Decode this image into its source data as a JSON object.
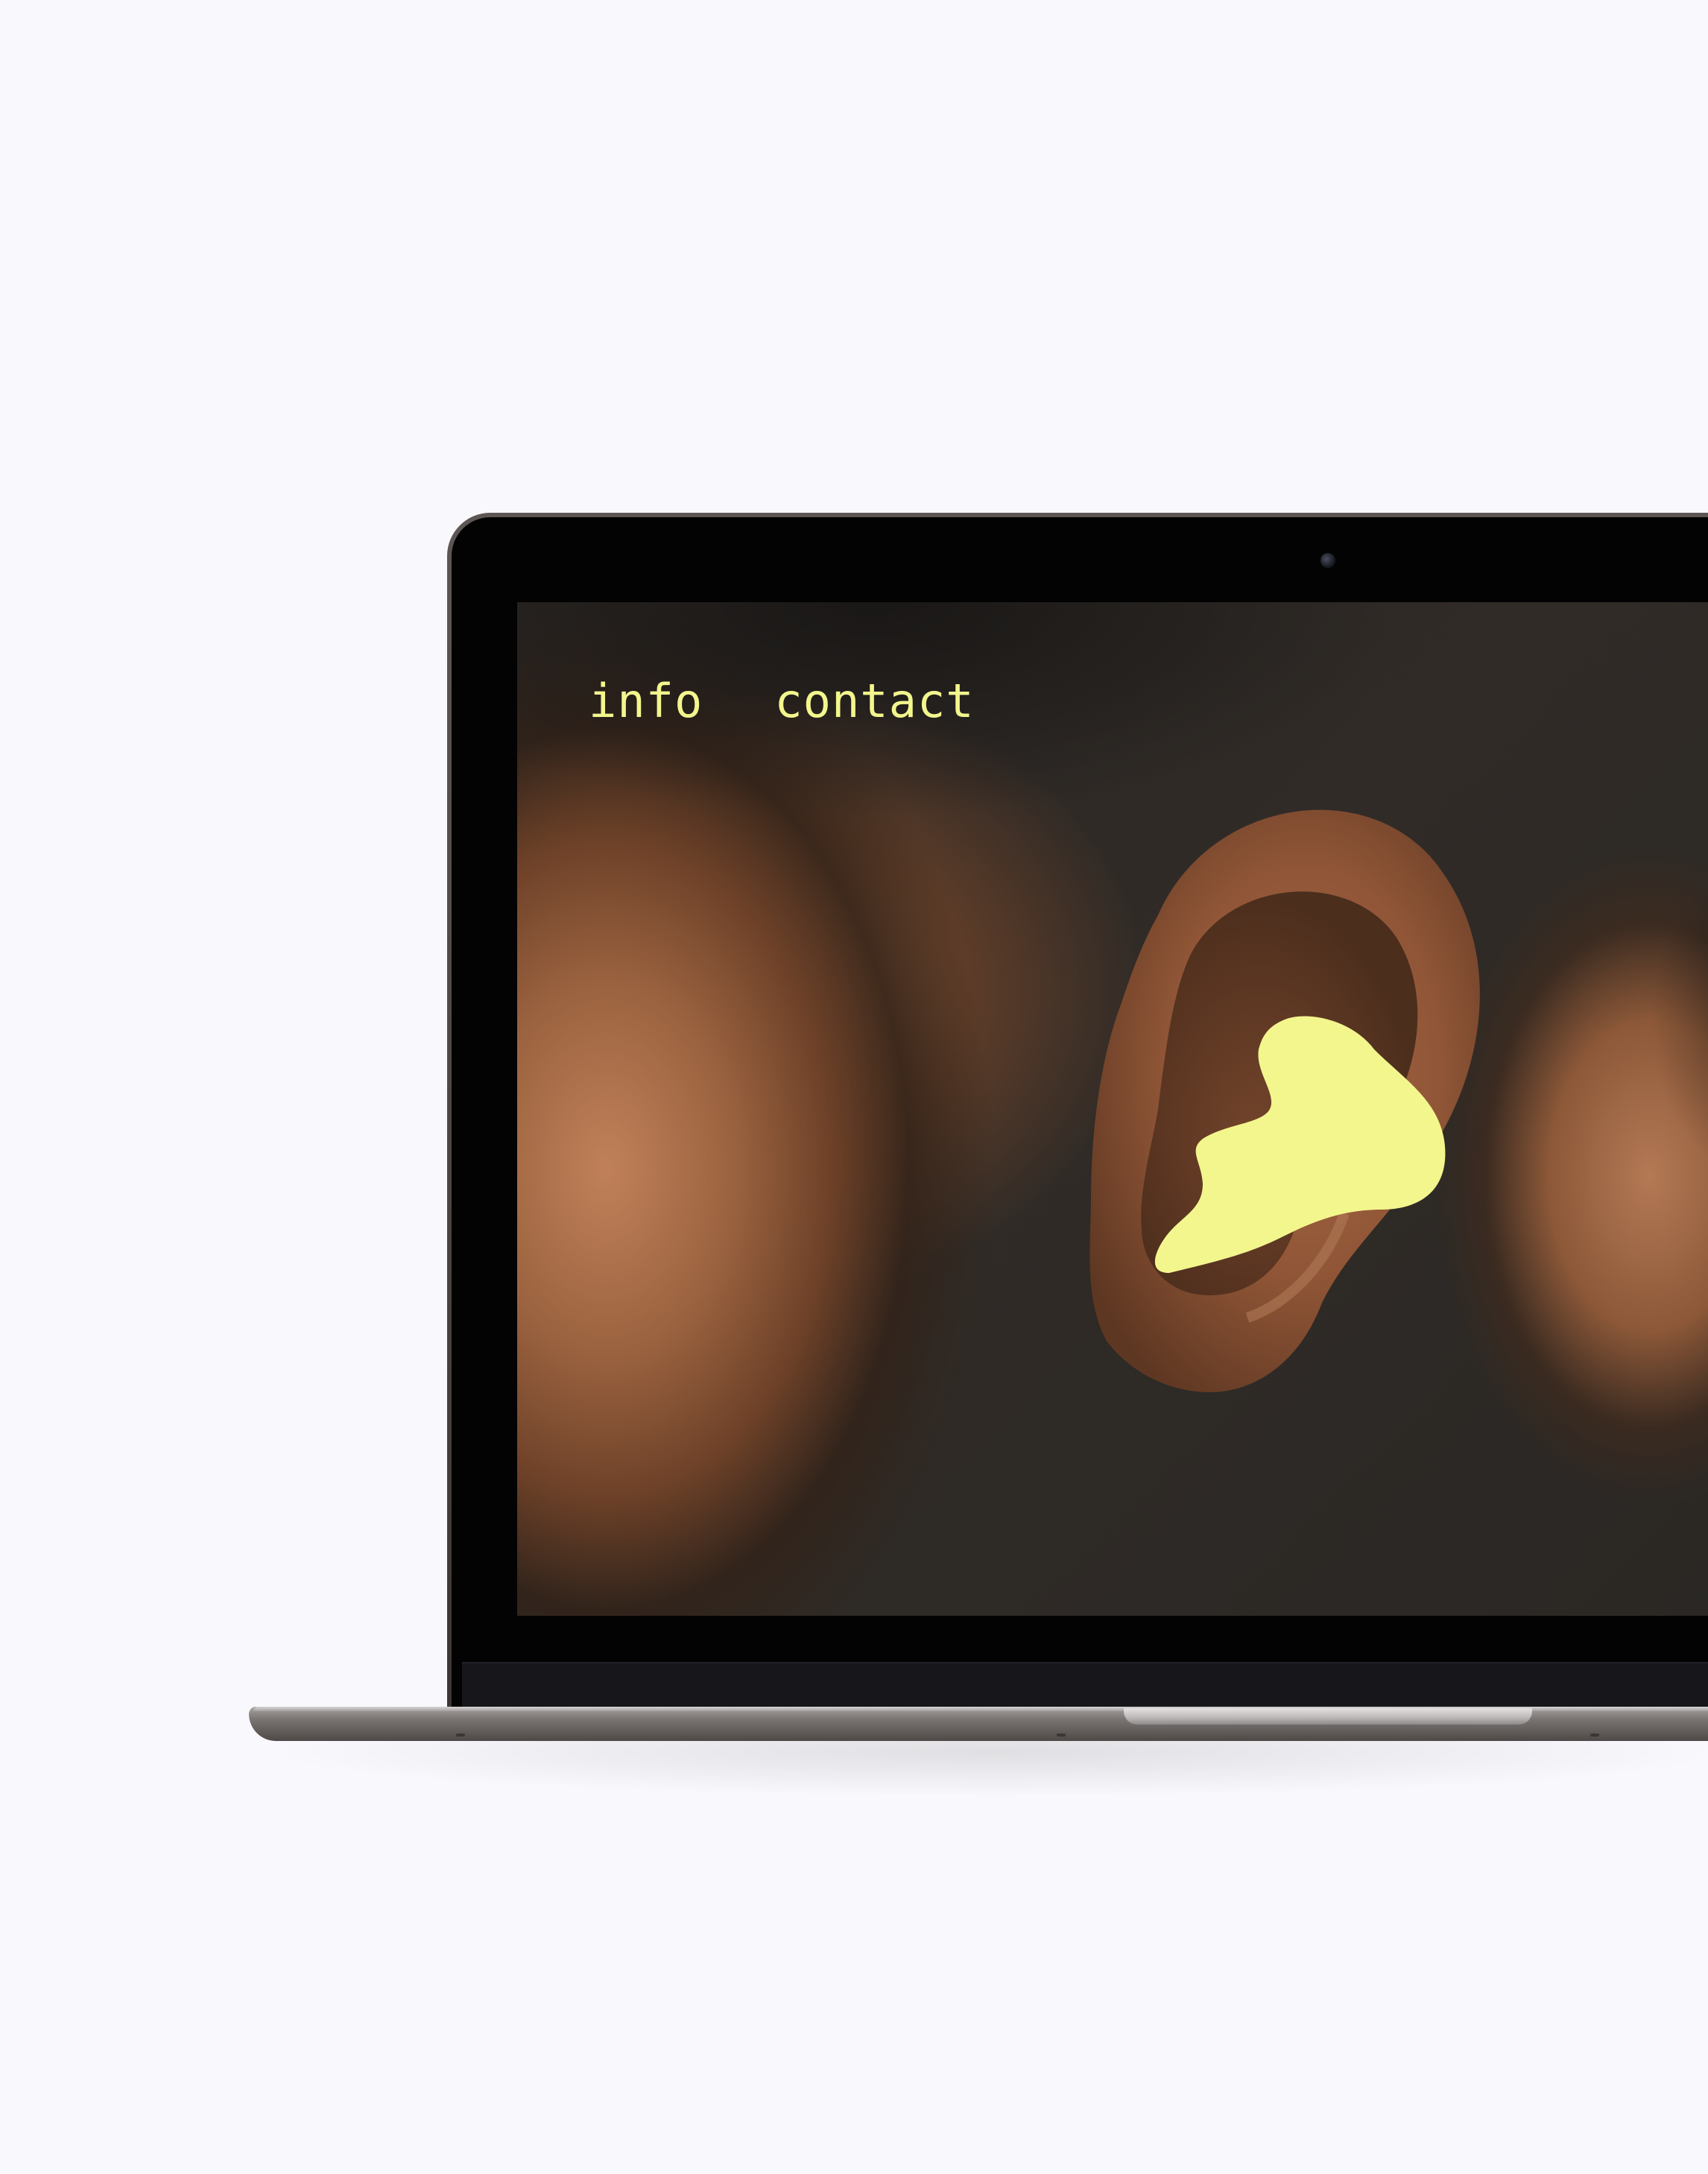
{
  "website": {
    "nav": [
      {
        "label": "info"
      },
      {
        "label": "contact"
      }
    ],
    "hero_image": "ear-photo",
    "accent_shape": "earplug-blob-shape"
  },
  "colors": {
    "accent": "#f3f68d",
    "background": "#f9f8fc",
    "bezel": "#030303"
  }
}
